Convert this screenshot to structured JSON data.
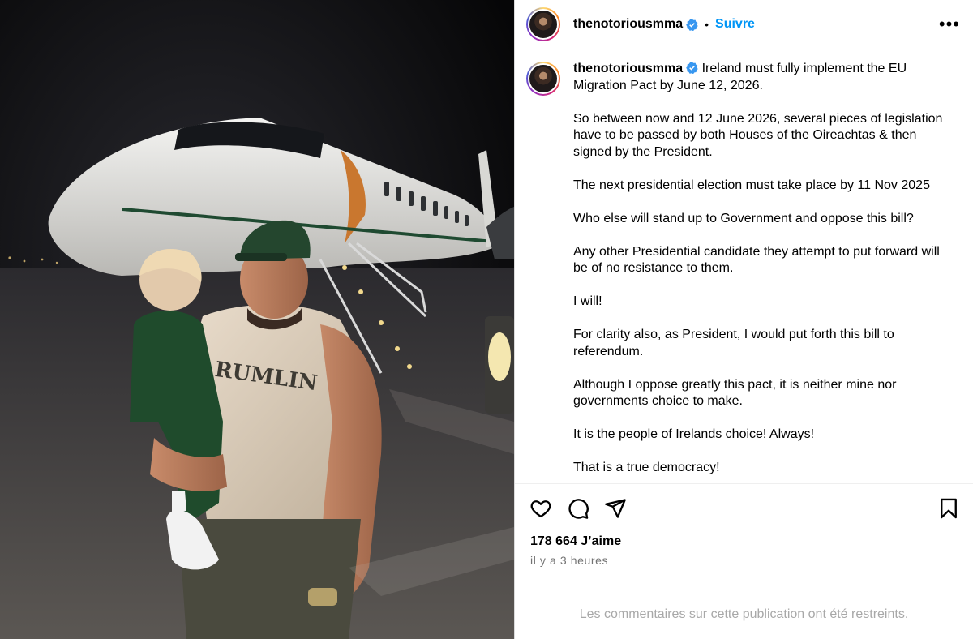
{
  "header": {
    "username": "thenotoriousmma",
    "dot": "•",
    "follow_label": "Suivre",
    "more_label": "•••"
  },
  "caption": {
    "username": "thenotoriousmma",
    "paragraphs": [
      "Ireland must fully implement the EU Migration Pact by June 12, 2026.",
      "So between now and 12 June 2026, several pieces of legislation have to be passed by both Houses of the Oireachtas & then signed by the President.",
      "The next presidential election must take place by 11 Nov 2025",
      "Who else will stand up to Government and oppose this bill?",
      "Any other Presidential candidate they attempt to put forward will be of no resistance to them.",
      "I will!",
      "For clarity also, as President, I would put forth this bill to referendum.",
      "Although I oppose greatly this pact, it is neither mine nor governments choice to make.",
      "It is the people of Irelands choice! Always!",
      "That is a true democracy!"
    ]
  },
  "stats": {
    "likes": "178 664 J’aime",
    "time": "il y a 3 heures"
  },
  "footer": {
    "restricted": "Les commentaires sur cette publication ont été restreints."
  },
  "icons": {
    "like": "heart-icon",
    "comment": "comment-icon",
    "share": "share-icon",
    "save": "bookmark-icon",
    "verified": "verified-badge-icon"
  },
  "colors": {
    "link": "#0095f6",
    "verified": "#3897f0",
    "muted": "#737373"
  }
}
